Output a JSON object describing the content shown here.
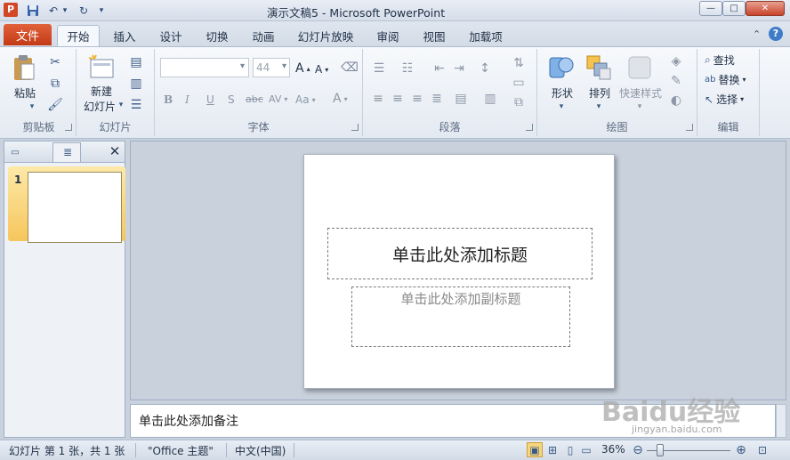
{
  "titlebar": {
    "title": "演示文稿5 - Microsoft PowerPoint",
    "app_icon": "P"
  },
  "tabs": {
    "file": "文件",
    "items": [
      "开始",
      "插入",
      "设计",
      "切换",
      "动画",
      "幻灯片放映",
      "审阅",
      "视图",
      "加载项"
    ]
  },
  "ribbon": {
    "clipboard": {
      "paste": "粘贴",
      "label": "剪贴板"
    },
    "slides": {
      "new_slide_line1": "新建",
      "new_slide_line2": "幻灯片",
      "label": "幻灯片"
    },
    "font": {
      "font_name": "",
      "font_size": "44",
      "label": "字体",
      "bold": "B",
      "italic": "I",
      "underline": "U",
      "shadow": "S",
      "strike": "abc",
      "spacing": "AV",
      "case": "Aa",
      "color": "A",
      "grow": "A",
      "shrink": "A"
    },
    "paragraph": {
      "label": "段落"
    },
    "drawing": {
      "shapes": "形状",
      "arrange": "排列",
      "quick_styles": "快速样式",
      "label": "绘图"
    },
    "editing": {
      "find": "查找",
      "replace": "替换",
      "select": "选择",
      "label": "编辑"
    }
  },
  "left_panel": {
    "slide_number": "1",
    "close": "✕"
  },
  "slide": {
    "title_placeholder": "单击此处添加标题",
    "subtitle_placeholder": "单击此处添加副标题"
  },
  "notes": {
    "placeholder": "单击此处添加备注"
  },
  "statusbar": {
    "slide_info": "幻灯片 第 1 张，共 1 张",
    "theme": "\"Office 主题\"",
    "language": "中文(中国)",
    "zoom": "36%",
    "zoom_level": 0.36
  },
  "watermark": {
    "text": "Baidu经验",
    "url": "jingyan.baidu.com"
  },
  "colors": {
    "file_tab": "#c43a17",
    "accent": "#3f7cc8",
    "thumb_highlight": "#f6c65c"
  }
}
